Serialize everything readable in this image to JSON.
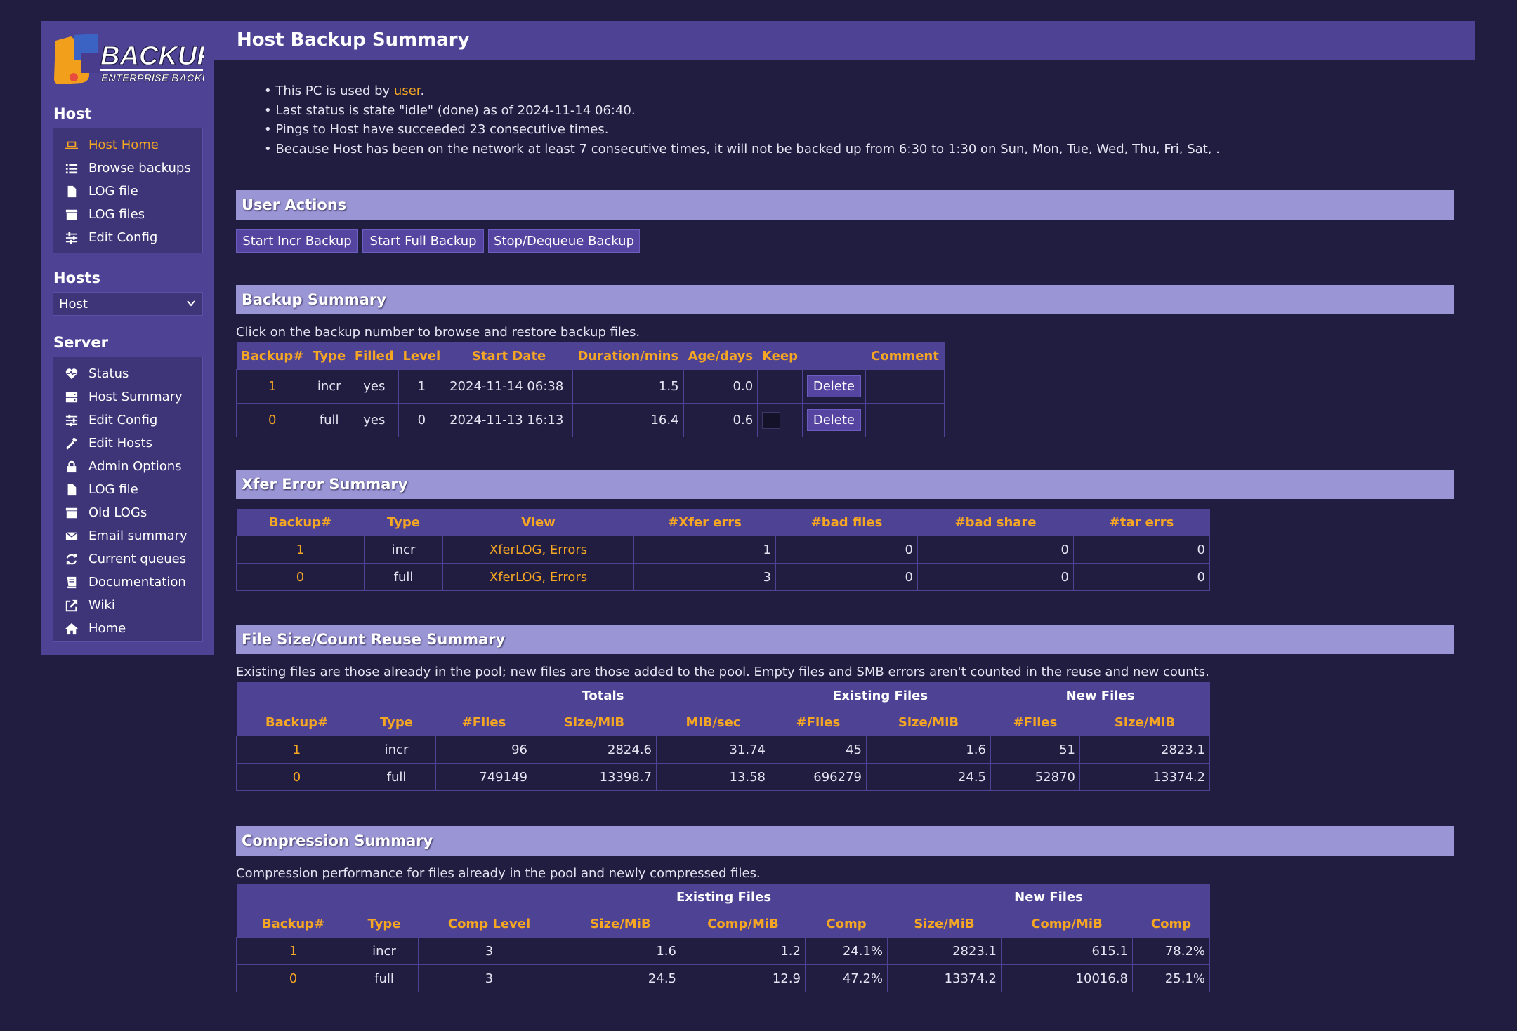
{
  "sidebar": {
    "logo": {
      "title": "BACKUP PC",
      "subtitle": "ENTERPRISE BACKUP"
    },
    "host_heading": "Host",
    "host_items": [
      {
        "label": "Host Home",
        "icon": "laptop-icon",
        "active": true
      },
      {
        "label": "Browse backups",
        "icon": "list-icon"
      },
      {
        "label": "LOG file",
        "icon": "file-icon"
      },
      {
        "label": "LOG files",
        "icon": "archive-icon"
      },
      {
        "label": "Edit Config",
        "icon": "sliders-icon"
      }
    ],
    "hosts_heading": "Hosts",
    "hosts_select_value": "Host",
    "server_heading": "Server",
    "server_items": [
      {
        "label": "Status",
        "icon": "heartbeat-icon"
      },
      {
        "label": "Host Summary",
        "icon": "server-icon"
      },
      {
        "label": "Edit Config",
        "icon": "sliders-icon"
      },
      {
        "label": "Edit Hosts",
        "icon": "wrench-icon"
      },
      {
        "label": "Admin Options",
        "icon": "lock-icon"
      },
      {
        "label": "LOG file",
        "icon": "file-icon"
      },
      {
        "label": "Old LOGs",
        "icon": "archive-icon"
      },
      {
        "label": "Email summary",
        "icon": "envelope-icon"
      },
      {
        "label": "Current queues",
        "icon": "refresh-icon"
      },
      {
        "label": "Documentation",
        "icon": "book-icon"
      },
      {
        "label": "Wiki",
        "icon": "external-link-icon"
      },
      {
        "label": "Home",
        "icon": "home-icon"
      }
    ]
  },
  "page": {
    "title": "Host Backup Summary",
    "info": {
      "line1_prefix": "This PC is used by ",
      "line1_user": "user",
      "line1_suffix": ".",
      "line2": "Last status is state \"idle\" (done) as of 2024-11-14 06:40.",
      "line3": "Pings to Host have succeeded 23 consecutive times.",
      "line4": "Because Host has been on the network at least 7 consecutive times, it will not be backed up from 6:30 to 1:30 on Sun, Mon, Tue, Wed, Thu, Fri, Sat, ."
    }
  },
  "user_actions": {
    "heading": "User Actions",
    "buttons": [
      "Start Incr Backup",
      "Start Full Backup",
      "Stop/Dequeue Backup"
    ]
  },
  "backup_summary": {
    "heading": "Backup Summary",
    "caption": "Click on the backup number to browse and restore backup files.",
    "headers": [
      "Backup#",
      "Type",
      "Filled",
      "Level",
      "Start Date",
      "Duration/mins",
      "Age/days",
      "Keep",
      "",
      "Comment"
    ],
    "delete_label": "Delete",
    "rows": [
      {
        "backup": "1",
        "type": "incr",
        "filled": "yes",
        "level": "1",
        "start": "2024-11-14 06:38",
        "duration": "1.5",
        "age": "0.0",
        "comment": ""
      },
      {
        "backup": "0",
        "type": "full",
        "filled": "yes",
        "level": "0",
        "start": "2024-11-13 16:13",
        "duration": "16.4",
        "age": "0.6",
        "comment": ""
      }
    ]
  },
  "xfer_summary": {
    "heading": "Xfer Error Summary",
    "headers": [
      "Backup#",
      "Type",
      "View",
      "#Xfer errs",
      "#bad files",
      "#bad share",
      "#tar errs"
    ],
    "rows": [
      {
        "backup": "1",
        "type": "incr",
        "view_log": "XferLOG",
        "view_sep": ", ",
        "view_err": "Errors",
        "xfer": "1",
        "badfiles": "0",
        "badshare": "0",
        "tar": "0"
      },
      {
        "backup": "0",
        "type": "full",
        "view_log": "XferLOG",
        "view_sep": ", ",
        "view_err": "Errors",
        "xfer": "3",
        "badfiles": "0",
        "badshare": "0",
        "tar": "0"
      }
    ]
  },
  "reuse_summary": {
    "heading": "File Size/Count Reuse Summary",
    "caption": "Existing files are those already in the pool; new files are those added to the pool. Empty files and SMB errors aren't counted in the reuse and new counts.",
    "group_headers": [
      "Totals",
      "Existing Files",
      "New Files"
    ],
    "headers": [
      "Backup#",
      "Type",
      "#Files",
      "Size/MiB",
      "MiB/sec",
      "#Files",
      "Size/MiB",
      "#Files",
      "Size/MiB"
    ],
    "rows": [
      [
        "1",
        "incr",
        "96",
        "2824.6",
        "31.74",
        "45",
        "1.6",
        "51",
        "2823.1"
      ],
      [
        "0",
        "full",
        "749149",
        "13398.7",
        "13.58",
        "696279",
        "24.5",
        "52870",
        "13374.2"
      ]
    ]
  },
  "compression_summary": {
    "heading": "Compression Summary",
    "caption": "Compression performance for files already in the pool and newly compressed files.",
    "group_headers": [
      "Existing Files",
      "New Files"
    ],
    "headers": [
      "Backup#",
      "Type",
      "Comp Level",
      "Size/MiB",
      "Comp/MiB",
      "Comp",
      "Size/MiB",
      "Comp/MiB",
      "Comp"
    ],
    "rows": [
      [
        "1",
        "incr",
        "3",
        "1.6",
        "1.2",
        "24.1%",
        "2823.1",
        "615.1",
        "78.2%"
      ],
      [
        "0",
        "full",
        "3",
        "24.5",
        "12.9",
        "47.2%",
        "13374.2",
        "10016.8",
        "25.1%"
      ]
    ]
  }
}
